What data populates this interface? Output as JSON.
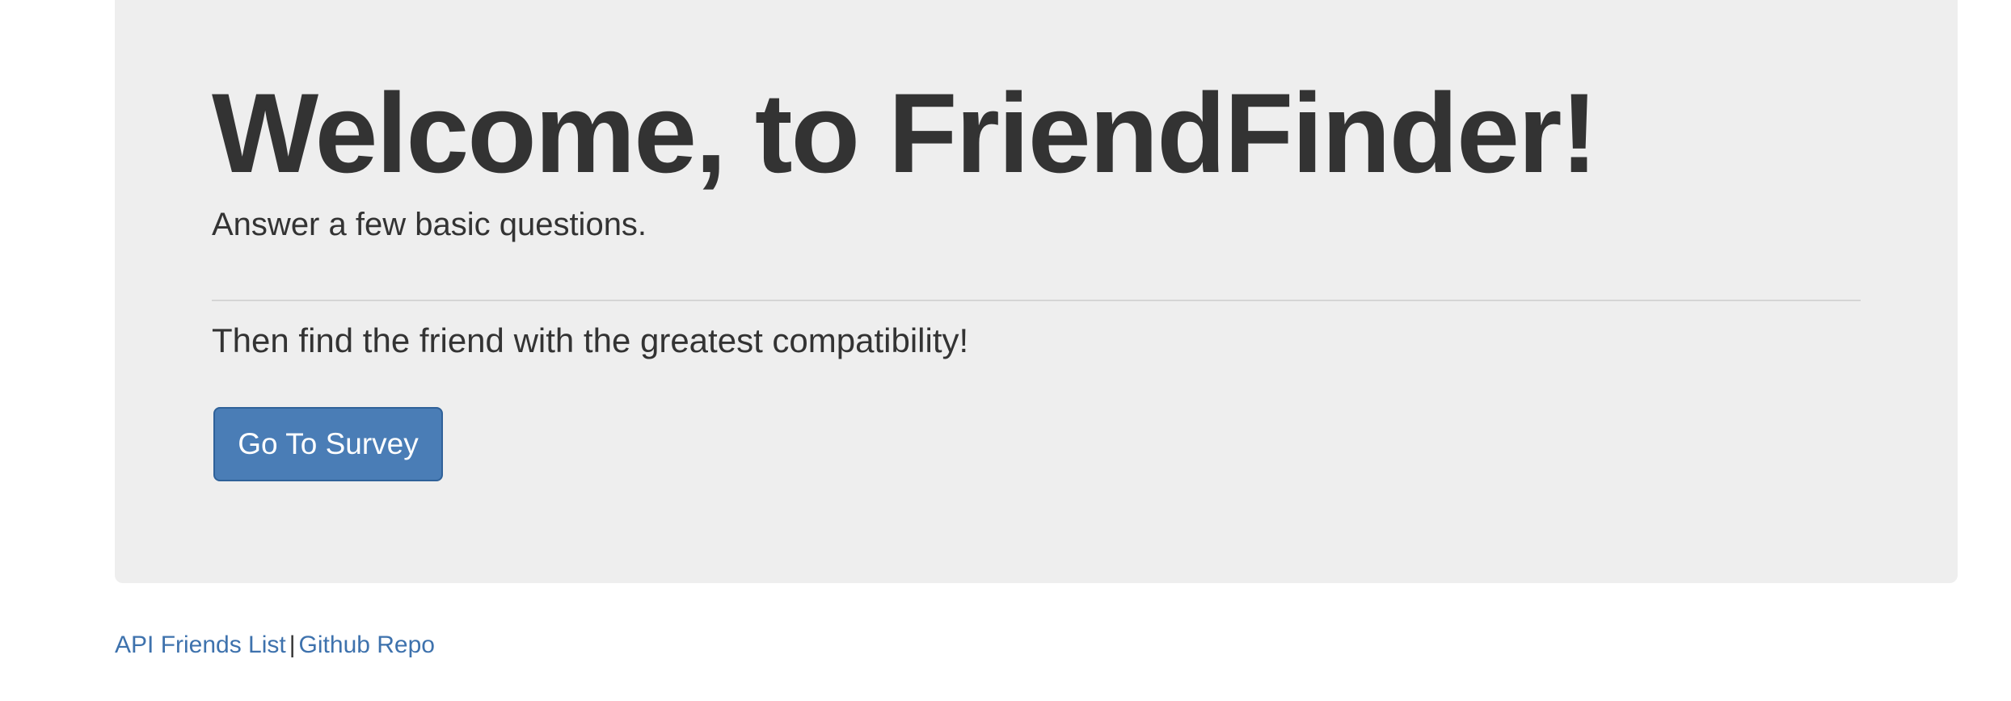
{
  "jumbotron": {
    "title": "Welcome, to FriendFinder!",
    "lead": "Answer a few basic questions.",
    "body": "Then find the friend with the greatest compatibility!",
    "button_label": "Go To Survey"
  },
  "footer": {
    "links": [
      {
        "label": "API Friends List"
      },
      {
        "label": "Github Repo"
      }
    ],
    "separator": "|"
  },
  "colors": {
    "jumbotron_bg": "#eeeeee",
    "button_bg": "#4a7db6",
    "link": "#3e72ad",
    "text": "#333333"
  }
}
